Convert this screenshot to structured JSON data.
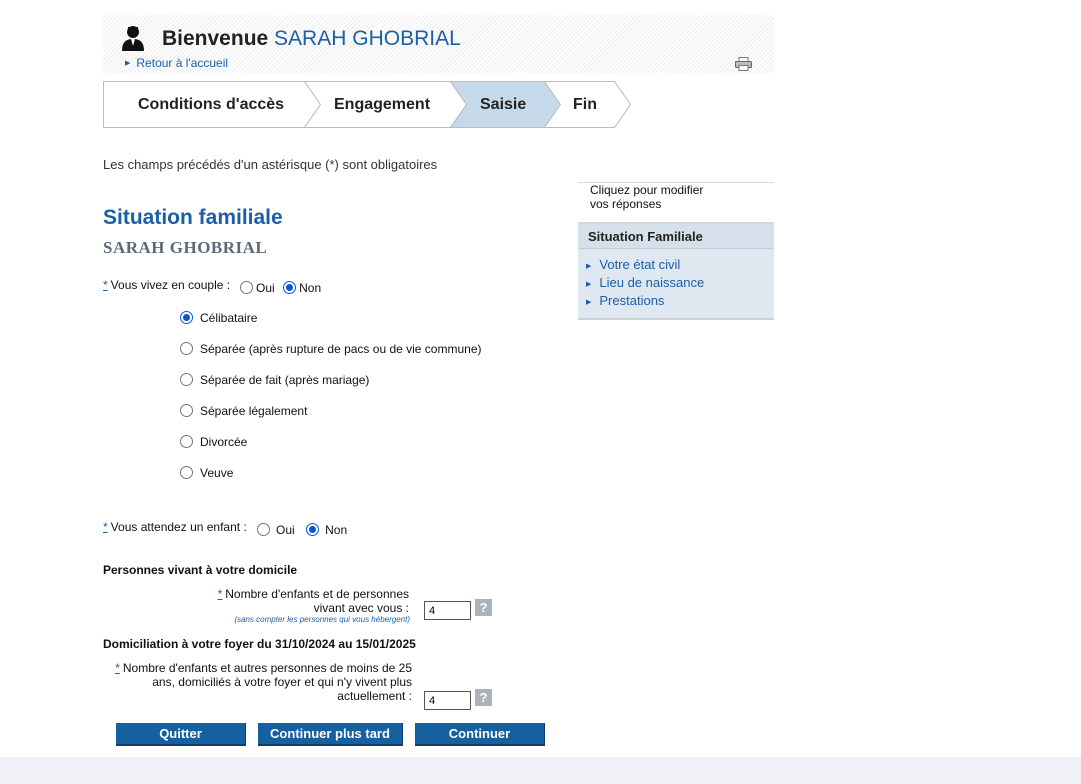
{
  "header": {
    "welcome": "Bienvenue",
    "user_name": "SARAH GHOBRIAL",
    "home_link": "Retour à l'accueil",
    "icons": {
      "user": "user-icon",
      "printer": "printer-icon"
    }
  },
  "stepper": {
    "steps": [
      {
        "label": "Conditions d'accès"
      },
      {
        "label": "Engagement"
      },
      {
        "label": "Saisie",
        "active": true
      },
      {
        "label": "Fin"
      }
    ],
    "active_color": "#c5d9ea"
  },
  "required_note": "Les champs précédés d'un astérisque (*) sont obligatoires",
  "section": {
    "title": "Situation familiale",
    "subtitle": "SARAH GHOBRIAL"
  },
  "couple": {
    "asterisk": "*",
    "label": "Vous vivez en couple :",
    "options": [
      "Oui",
      "Non"
    ],
    "selected": "Non"
  },
  "status": {
    "selected": "Célibataire",
    "options": [
      "Célibataire",
      "Séparée (après rupture de pacs ou de vie commune)",
      "Séparée de fait (après mariage)",
      "Séparée légalement",
      "Divorcée",
      "Veuve"
    ]
  },
  "expecting": {
    "asterisk": "*",
    "label": "Vous attendez un enfant :",
    "options": [
      "Oui",
      "Non"
    ],
    "selected": "Non"
  },
  "household": {
    "title": "Personnes vivant à votre domicile",
    "asterisk": "*",
    "label_line1": "Nombre d'enfants et de personnes",
    "label_line2": "vivant avec vous :",
    "hint": "(sans compter les personnes qui vous hébergent)",
    "value": "4",
    "help": "?"
  },
  "domiciliation": {
    "title": "Domiciliation à votre foyer du 31/10/2024 au 15/01/2025",
    "asterisk": "*",
    "label_line1": "Nombre d'enfants et autres personnes de moins de 25",
    "label_line2": "ans, domiciliés à votre foyer et qui n'y vivent plus",
    "label_line3": "actuellement :",
    "value": "4",
    "help": "?"
  },
  "buttons": {
    "quit": "Quitter",
    "later": "Continuer plus tard",
    "continue": "Continuer"
  },
  "sidebar": {
    "note_line1": "Cliquez pour modifier",
    "note_line2": "vos réponses",
    "heading": "Situation Familiale",
    "links": [
      "Votre état civil",
      "Lieu de naissance",
      "Prestations"
    ]
  }
}
